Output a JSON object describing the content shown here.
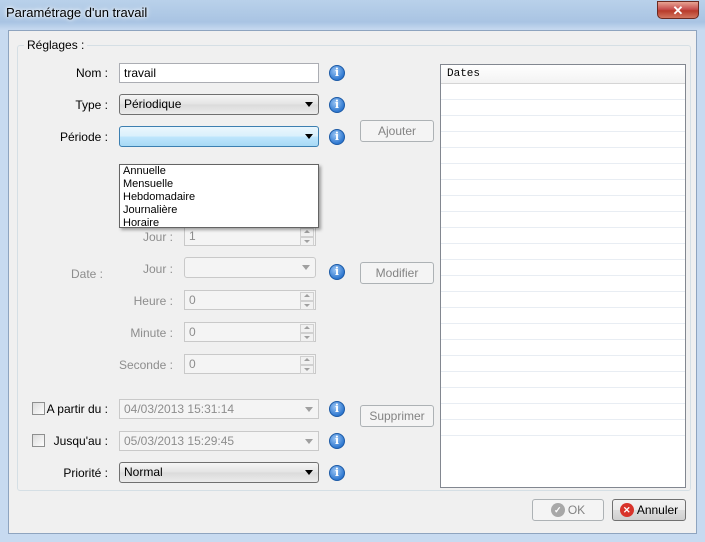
{
  "window": {
    "title": "Paramétrage d'un travail",
    "close_label": "✕"
  },
  "group": {
    "legend": "Réglages :"
  },
  "fields": {
    "nom_label": "Nom :",
    "nom_value": "travail",
    "type_label": "Type :",
    "type_value": "Périodique",
    "periode_label": "Période :",
    "periode_value": "",
    "periode_options": [
      "Annuelle",
      "Mensuelle",
      "Hebdomadaire",
      "Journalière",
      "Horaire"
    ],
    "date_label": "Date :",
    "jour1_label": "Jour :",
    "jour1_value": "1",
    "jour2_label": "Jour :",
    "jour2_value": "",
    "heure_label": "Heure :",
    "heure_value": "0",
    "minute_label": "Minute :",
    "minute_value": "0",
    "seconde_label": "Seconde :",
    "seconde_value": "0",
    "apartir_label": "A partir du :",
    "apartir_value": "04/03/2013 15:31:14",
    "jusquau_label": "Jusqu'au :",
    "jusquau_value": "05/03/2013 15:29:45",
    "priorite_label": "Priorité :",
    "priorite_value": "Normal",
    "info_glyph": "i"
  },
  "buttons": {
    "ajouter": "Ajouter",
    "modifier": "Modifier",
    "supprimer": "Supprimer",
    "ok": "OK",
    "annuler": "Annuler"
  },
  "icons": {
    "ok_glyph": "✓",
    "annuler_glyph": "✕"
  },
  "list": {
    "header": "Dates",
    "rows": 22
  },
  "colors": {
    "info_blue": "#2f78d0",
    "cancel_red": "#d8332a",
    "ok_gray": "#9a9a9a"
  }
}
